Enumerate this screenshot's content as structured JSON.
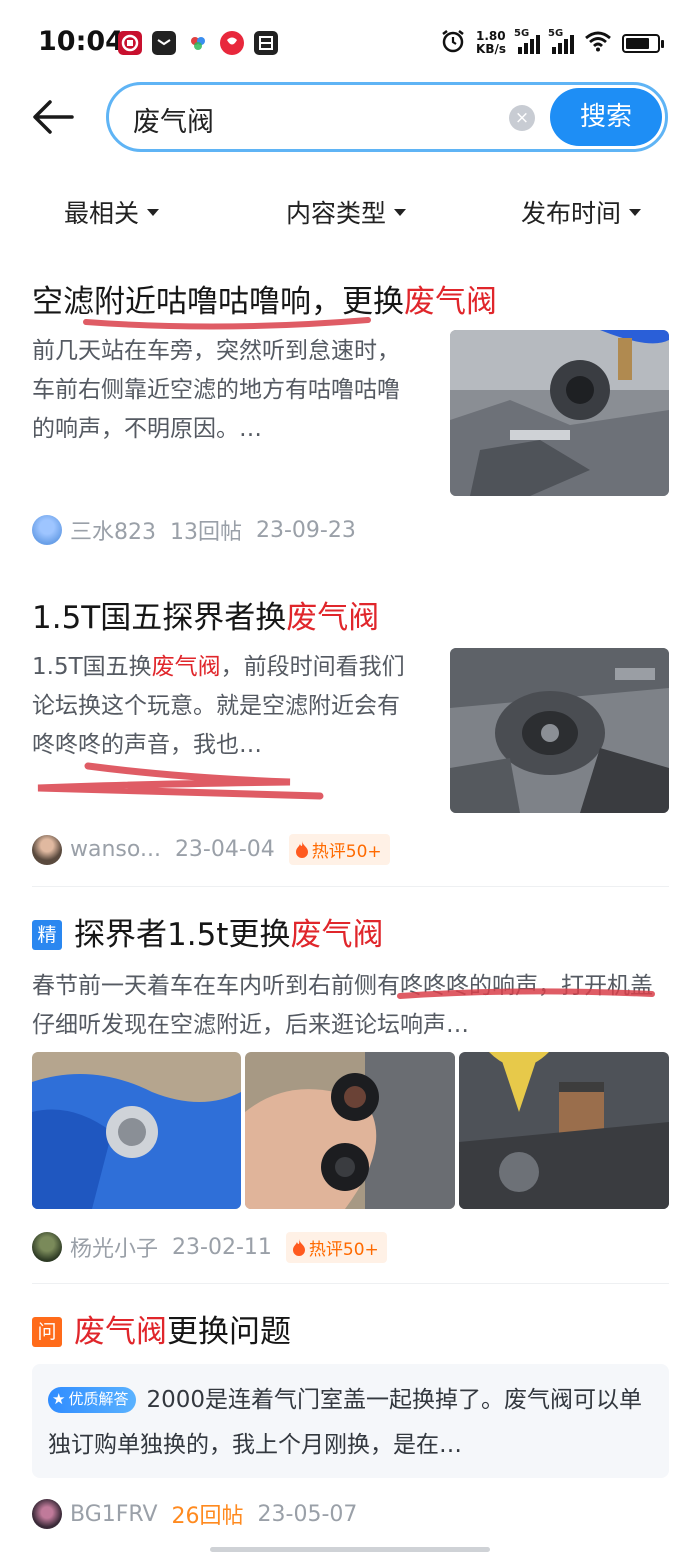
{
  "status_bar": {
    "time": "10:04",
    "net_speed_value": "1.80",
    "net_speed_unit": "KB/s",
    "sim1": "5G",
    "sim2": "5G",
    "icons": [
      "alarm-icon",
      "signal-icon",
      "signal-icon",
      "wifi-icon",
      "battery-icon"
    ],
    "app_icons": [
      "bank-app-icon",
      "messages-app-icon",
      "photos-app-icon",
      "red-app-icon",
      "inbox-app-icon"
    ]
  },
  "search": {
    "query": "废气阀",
    "button_label": "搜索"
  },
  "filters": [
    {
      "label": "最相关"
    },
    {
      "label": "内容类型"
    },
    {
      "label": "发布时间"
    }
  ],
  "posts": [
    {
      "title_pre": "空滤附近咕噜咕噜响，更换",
      "title_hl": "废气阀",
      "excerpt": "前几天站在车旁，突然听到怠速时，车前右侧靠近空滤的地方有咕噜咕噜的响声，不明原因。…",
      "author": "三水823",
      "replies": "13回帖",
      "date": "23-09-23"
    },
    {
      "title_pre": "1.5T国五探界者换",
      "title_hl": "废气阀",
      "excerpt_pre": "1.5T国五换",
      "excerpt_hl": "废气阀",
      "excerpt_post": "，前段时间看我们论坛换这个玩意。就是空滤附近会有咚咚咚的声音，我也…",
      "author": "wanso...",
      "date": "23-04-04",
      "hot": "热评50+"
    },
    {
      "tag": "精",
      "title_pre": "探界者1.5t更换",
      "title_hl": "废气阀",
      "excerpt": "春节前一天着车在车内听到右前侧有咚咚咚的响声，打开机盖仔细听发现在空滤附近，后来逛论坛响声…",
      "author": "杨光小子",
      "date": "23-02-11",
      "hot": "热评50+"
    },
    {
      "tag": "问",
      "title_hl": "废气阀",
      "title_post": "更换问题",
      "answer_badge": "优质解答",
      "answer": "2000是连着气门室盖一起换掉了。废气阀可以单独订购单独换的，我上个月刚换，是在…",
      "author": "BG1FRV",
      "replies": "26回帖",
      "date": "23-05-07"
    }
  ],
  "colors": {
    "accent": "#1e8ef5",
    "highlight": "#e0262b",
    "hot": "#ff6a00",
    "tag_jing": "#2a87f0",
    "tag_wen": "#ff6b1a"
  }
}
